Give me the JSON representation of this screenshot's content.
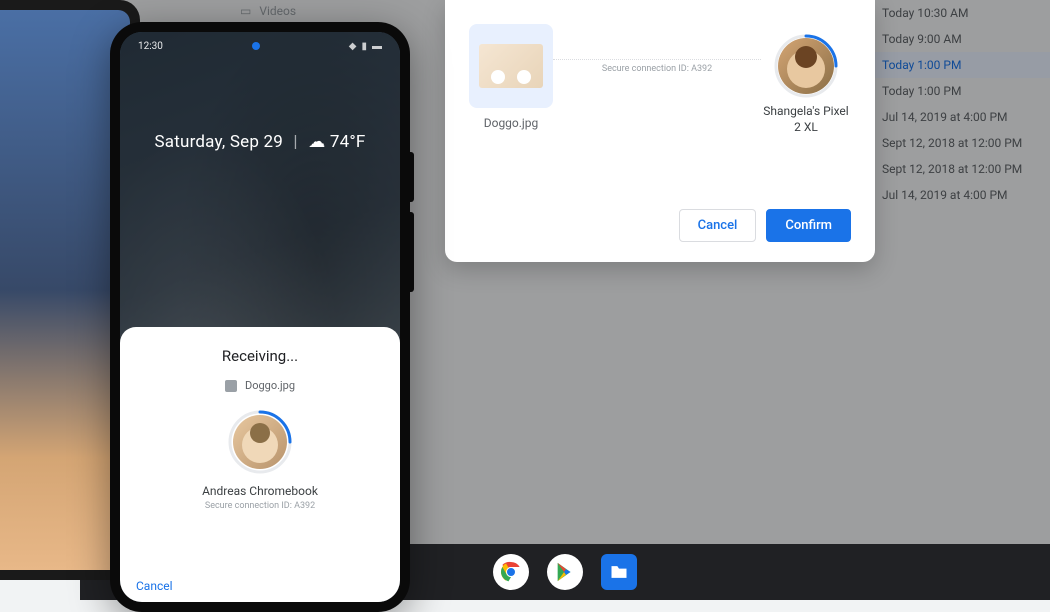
{
  "sidebar": {
    "videos_label": "Videos"
  },
  "timelist": {
    "items": [
      {
        "label": "Today 10:30 AM",
        "selected": false
      },
      {
        "label": "Today 9:00 AM",
        "selected": false
      },
      {
        "label": "Today 1:00 PM",
        "selected": true
      },
      {
        "label": "Today 1:00 PM",
        "selected": false
      },
      {
        "label": "Jul 14, 2019 at 4:00 PM",
        "selected": false
      },
      {
        "label": "Sept 12, 2018 at 12:00 PM",
        "selected": false
      },
      {
        "label": "Sept 12, 2018 at 12:00 PM",
        "selected": false
      },
      {
        "label": "Jul 14, 2019 at 4:00 PM",
        "selected": false
      }
    ]
  },
  "dialog": {
    "file_name": "Doggo.jpg",
    "connection_id_text": "Secure connection ID: A392",
    "recipient_name": "Shangela's Pixel 2 XL",
    "cancel_label": "Cancel",
    "confirm_label": "Confirm"
  },
  "phone": {
    "status_time": "12:30",
    "lock_date": "Saturday, Sep 29",
    "lock_weather": "74°F",
    "sheet": {
      "title": "Receiving...",
      "file_name": "Doggo.jpg",
      "sender_name": "Andreas Chromebook",
      "connection_id_text": "Secure connection ID: A392",
      "cancel_label": "Cancel"
    }
  },
  "taskbar": {
    "apps": [
      "chrome",
      "play-store",
      "files"
    ]
  },
  "colors": {
    "primary": "#1a73e8",
    "text_secondary": "#5f6368"
  }
}
